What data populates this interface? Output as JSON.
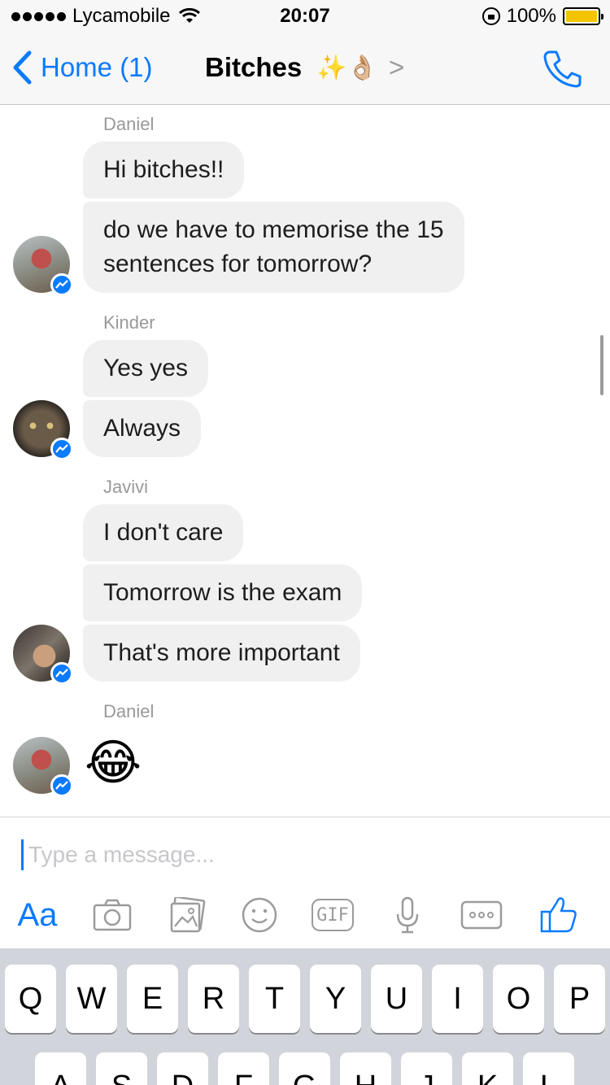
{
  "status_bar": {
    "carrier": "Lycamobile",
    "time": "20:07",
    "battery": "100%",
    "battery_color": "#f5c400"
  },
  "nav": {
    "back_label": "Home (1)",
    "title": "Bitches",
    "title_emoji": "✨👌🏼",
    "chevron": ">",
    "icons": [
      "back-chevron-icon",
      "phone-icon"
    ]
  },
  "chat": {
    "groups": [
      {
        "sender": "Daniel",
        "messages": [
          "Hi bitches!!",
          "do we have to memorise the 15",
          "sentences for tomorrow?"
        ]
      },
      {
        "sender": "Kinder",
        "messages": [
          "Yes yes",
          "Always"
        ]
      },
      {
        "sender": "Javivi",
        "messages": [
          "I don't care",
          "Tomorrow is the exam",
          "That's more important"
        ]
      },
      {
        "sender": "Daniel",
        "messages": [
          "😂"
        ]
      }
    ]
  },
  "composer": {
    "placeholder": "Type a message...",
    "aa_label": "Aa",
    "gif_label": "GIF",
    "tool_icons": [
      "text-format-icon",
      "camera-icon",
      "photo-icon",
      "emoji-icon",
      "gif-icon",
      "microphone-icon",
      "more-icon",
      "like-icon"
    ]
  },
  "keyboard": {
    "row1": [
      "Q",
      "W",
      "E",
      "R",
      "T",
      "Y",
      "U",
      "I",
      "O",
      "P"
    ],
    "row2": [
      "A",
      "S",
      "D",
      "F",
      "G",
      "H",
      "J",
      "K",
      "L"
    ]
  },
  "colors": {
    "accent": "#0a7aff",
    "bubble": "#f1f0f0",
    "bar": "#f7f7f7",
    "keyboard": "#d1d5db"
  }
}
